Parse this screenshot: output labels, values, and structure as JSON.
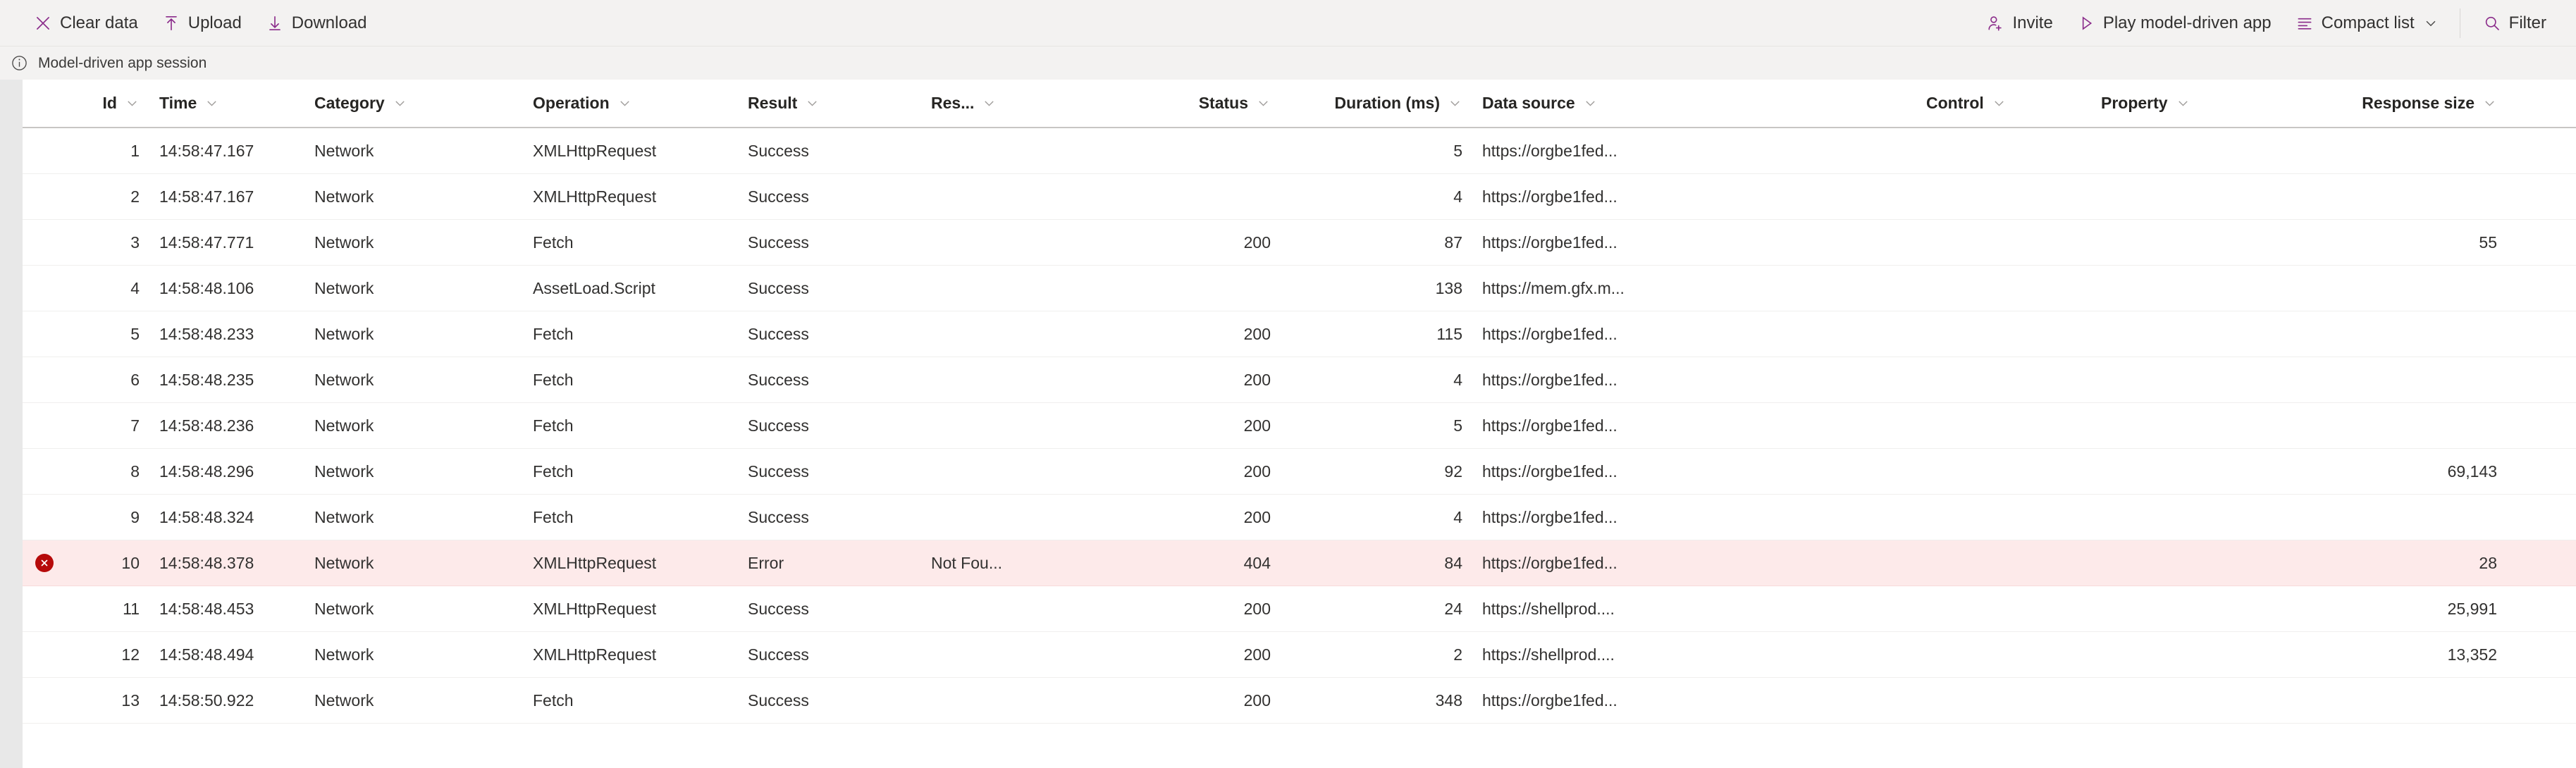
{
  "toolbar": {
    "left_buttons": [
      {
        "id": "clear-data",
        "label": "Clear data",
        "icon": "close-x-icon"
      },
      {
        "id": "upload",
        "label": "Upload",
        "icon": "upload-arrow-icon"
      },
      {
        "id": "download",
        "label": "Download",
        "icon": "download-arrow-icon"
      }
    ],
    "right_buttons": [
      {
        "id": "invite",
        "label": "Invite",
        "icon": "person-add-icon",
        "chevron": false
      },
      {
        "id": "play-model-driven",
        "label": "Play model-driven app",
        "icon": "play-triangle-icon",
        "chevron": false
      },
      {
        "id": "compact-list",
        "label": "Compact list",
        "icon": "list-lines-icon",
        "chevron": true
      },
      {
        "id": "filter",
        "label": "Filter",
        "icon": "search-icon",
        "chevron": false
      }
    ]
  },
  "session": {
    "icon": "info-circle-icon",
    "text": "Model-driven app session"
  },
  "grid": {
    "columns": [
      {
        "key": "id",
        "label": "Id",
        "align": "right",
        "cls": "c-id"
      },
      {
        "key": "time",
        "label": "Time",
        "align": "left",
        "cls": "c-time"
      },
      {
        "key": "cat",
        "label": "Category",
        "align": "left",
        "cls": "c-cat"
      },
      {
        "key": "op",
        "label": "Operation",
        "align": "left",
        "cls": "c-op"
      },
      {
        "key": "result",
        "label": "Result",
        "align": "left",
        "cls": "c-res"
      },
      {
        "key": "rmsg",
        "label": "Res...",
        "align": "left",
        "cls": "c-rmsg"
      },
      {
        "key": "status",
        "label": "Status",
        "align": "right",
        "cls": "c-stat"
      },
      {
        "key": "dur",
        "label": "Duration (ms)",
        "align": "right",
        "cls": "c-dur"
      },
      {
        "key": "src",
        "label": "Data source",
        "align": "left",
        "cls": "c-src"
      },
      {
        "key": "ctrl",
        "label": "Control",
        "align": "left",
        "cls": "c-ctrl"
      },
      {
        "key": "prop",
        "label": "Property",
        "align": "left",
        "cls": "c-prop"
      },
      {
        "key": "size",
        "label": "Response size",
        "align": "right",
        "cls": "c-size"
      }
    ],
    "rows": [
      {
        "state": "ok",
        "id": "1",
        "time": "14:58:47.167",
        "cat": "Network",
        "op": "XMLHttpRequest",
        "result": "Success",
        "rmsg": "",
        "status": "",
        "dur": "5",
        "src": "https://orgbe1fed...",
        "ctrl": "",
        "prop": "",
        "size": ""
      },
      {
        "state": "ok",
        "id": "2",
        "time": "14:58:47.167",
        "cat": "Network",
        "op": "XMLHttpRequest",
        "result": "Success",
        "rmsg": "",
        "status": "",
        "dur": "4",
        "src": "https://orgbe1fed...",
        "ctrl": "",
        "prop": "",
        "size": ""
      },
      {
        "state": "ok",
        "id": "3",
        "time": "14:58:47.771",
        "cat": "Network",
        "op": "Fetch",
        "result": "Success",
        "rmsg": "",
        "status": "200",
        "dur": "87",
        "src": "https://orgbe1fed...",
        "ctrl": "",
        "prop": "",
        "size": "55"
      },
      {
        "state": "ok",
        "id": "4",
        "time": "14:58:48.106",
        "cat": "Network",
        "op": "AssetLoad.Script",
        "result": "Success",
        "rmsg": "",
        "status": "",
        "dur": "138",
        "src": "https://mem.gfx.m...",
        "ctrl": "",
        "prop": "",
        "size": ""
      },
      {
        "state": "ok",
        "id": "5",
        "time": "14:58:48.233",
        "cat": "Network",
        "op": "Fetch",
        "result": "Success",
        "rmsg": "",
        "status": "200",
        "dur": "115",
        "src": "https://orgbe1fed...",
        "ctrl": "",
        "prop": "",
        "size": ""
      },
      {
        "state": "ok",
        "id": "6",
        "time": "14:58:48.235",
        "cat": "Network",
        "op": "Fetch",
        "result": "Success",
        "rmsg": "",
        "status": "200",
        "dur": "4",
        "src": "https://orgbe1fed...",
        "ctrl": "",
        "prop": "",
        "size": ""
      },
      {
        "state": "ok",
        "id": "7",
        "time": "14:58:48.236",
        "cat": "Network",
        "op": "Fetch",
        "result": "Success",
        "rmsg": "",
        "status": "200",
        "dur": "5",
        "src": "https://orgbe1fed...",
        "ctrl": "",
        "prop": "",
        "size": ""
      },
      {
        "state": "ok",
        "id": "8",
        "time": "14:58:48.296",
        "cat": "Network",
        "op": "Fetch",
        "result": "Success",
        "rmsg": "",
        "status": "200",
        "dur": "92",
        "src": "https://orgbe1fed...",
        "ctrl": "",
        "prop": "",
        "size": "69,143"
      },
      {
        "state": "ok",
        "id": "9",
        "time": "14:58:48.324",
        "cat": "Network",
        "op": "Fetch",
        "result": "Success",
        "rmsg": "",
        "status": "200",
        "dur": "4",
        "src": "https://orgbe1fed...",
        "ctrl": "",
        "prop": "",
        "size": ""
      },
      {
        "state": "error",
        "id": "10",
        "time": "14:58:48.378",
        "cat": "Network",
        "op": "XMLHttpRequest",
        "result": "Error",
        "rmsg": "Not Fou...",
        "status": "404",
        "dur": "84",
        "src": "https://orgbe1fed...",
        "ctrl": "",
        "prop": "",
        "size": "28"
      },
      {
        "state": "ok",
        "id": "11",
        "time": "14:58:48.453",
        "cat": "Network",
        "op": "XMLHttpRequest",
        "result": "Success",
        "rmsg": "",
        "status": "200",
        "dur": "24",
        "src": "https://shellprod....",
        "ctrl": "",
        "prop": "",
        "size": "25,991"
      },
      {
        "state": "ok",
        "id": "12",
        "time": "14:58:48.494",
        "cat": "Network",
        "op": "XMLHttpRequest",
        "result": "Success",
        "rmsg": "",
        "status": "200",
        "dur": "2",
        "src": "https://shellprod....",
        "ctrl": "",
        "prop": "",
        "size": "13,352"
      },
      {
        "state": "ok",
        "id": "13",
        "time": "14:58:50.922",
        "cat": "Network",
        "op": "Fetch",
        "result": "Success",
        "rmsg": "",
        "status": "200",
        "dur": "348",
        "src": "https://orgbe1fed...",
        "ctrl": "",
        "prop": "",
        "size": ""
      }
    ]
  },
  "colors": {
    "accent": "#8a2b8a",
    "toolbar_bg": "#f3f2f1",
    "error_row_bg": "#fdeaea",
    "error_badge": "#b60a0a",
    "text": "#323130"
  }
}
